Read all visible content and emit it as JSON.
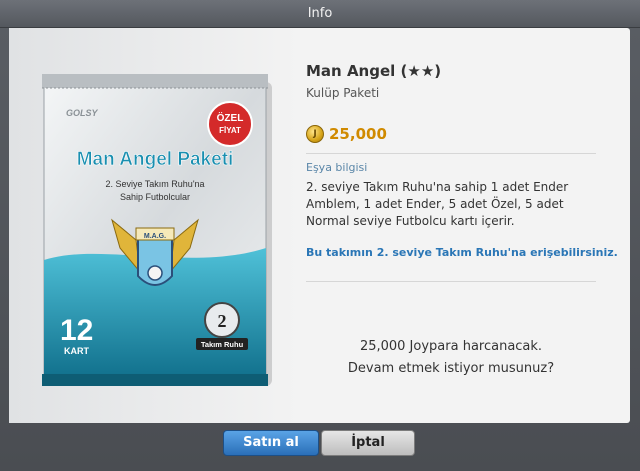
{
  "window": {
    "title": "Info"
  },
  "product": {
    "name": "Man Angel (★★)",
    "category": "Kulüp Paketi",
    "price": "25,000"
  },
  "pack_image": {
    "brand": "GOLSY",
    "badge_line1": "ÖZEL",
    "badge_line2": "FİYAT",
    "pack_title": "Man Angel Paketi",
    "pack_desc_line1": "2. Seviye Takım Ruhu'na",
    "pack_desc_line2": "Sahip Futbolcular",
    "crest_text": "M.A.G.",
    "card_count": "12",
    "card_unit": "KART",
    "spirit_level": "2",
    "spirit_label": "Takım Ruhu"
  },
  "info": {
    "heading": "Eşya bilgisi",
    "description": "2. seviye Takım Ruhu'na sahip 1 adet Ender Amblem, 1 adet Ender, 5 adet Özel, 5 adet Normal seviye Futbolcu kartı içerir.",
    "access_note": "Bu takımın 2. seviye Takım Ruhu'na erişebilirsiniz."
  },
  "confirm": {
    "line1": "25,000 Joypara harcanacak.",
    "line2": "Devam etmek istiyor musunuz?"
  },
  "buttons": {
    "buy": "Satın al",
    "cancel": "İptal"
  },
  "colors": {
    "accent_blue": "#2a6fb8",
    "price_gold": "#d08a00",
    "pack_teal": "#1f93b3"
  }
}
